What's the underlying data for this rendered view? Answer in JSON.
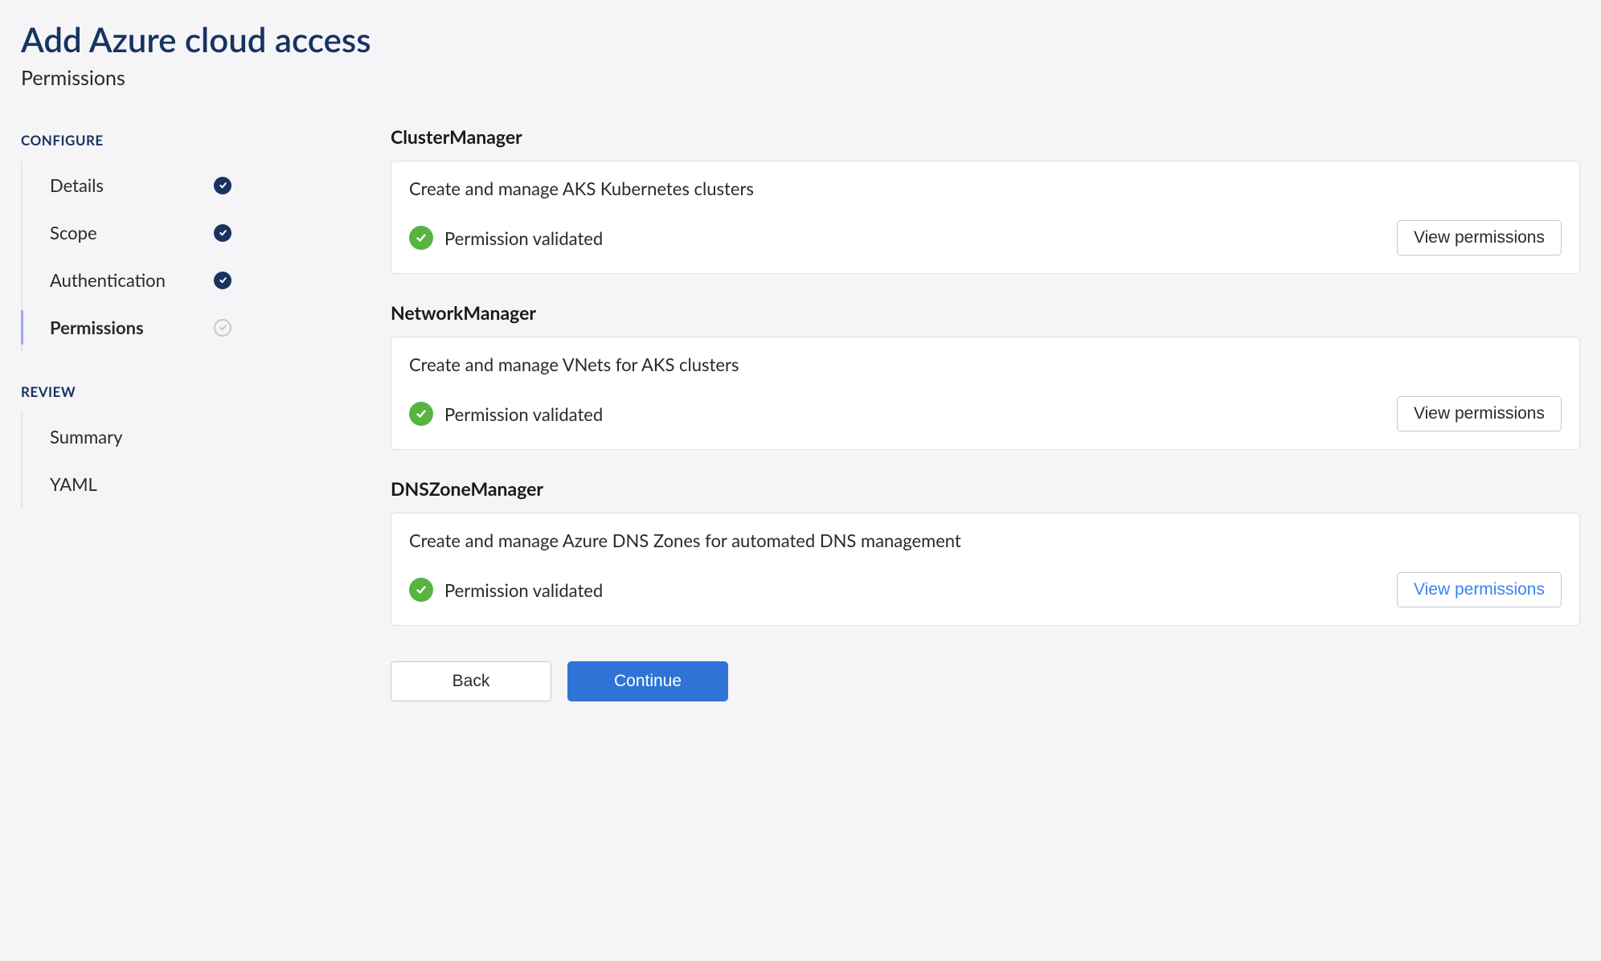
{
  "header": {
    "title": "Add Azure cloud access",
    "subtitle": "Permissions"
  },
  "sidebar": {
    "sections": [
      {
        "label": "CONFIGURE",
        "steps": [
          {
            "label": "Details",
            "state": "done"
          },
          {
            "label": "Scope",
            "state": "done"
          },
          {
            "label": "Authentication",
            "state": "done"
          },
          {
            "label": "Permissions",
            "state": "active"
          }
        ]
      },
      {
        "label": "REVIEW",
        "steps": [
          {
            "label": "Summary",
            "state": "upcoming"
          },
          {
            "label": "YAML",
            "state": "upcoming"
          }
        ]
      }
    ]
  },
  "permissions": [
    {
      "title": "ClusterManager",
      "description": "Create and manage AKS Kubernetes clusters",
      "status_text": "Permission validated",
      "status": "validated",
      "view_label": "View permissions",
      "view_hover": false
    },
    {
      "title": "NetworkManager",
      "description": "Create and manage VNets for AKS clusters",
      "status_text": "Permission validated",
      "status": "validated",
      "view_label": "View permissions",
      "view_hover": false
    },
    {
      "title": "DNSZoneManager",
      "description": "Create and manage Azure DNS Zones for automated DNS management",
      "status_text": "Permission validated",
      "status": "validated",
      "view_label": "View permissions",
      "view_hover": true
    }
  ],
  "actions": {
    "back_label": "Back",
    "continue_label": "Continue"
  },
  "colors": {
    "heading": "#173361",
    "primary_button": "#2f73d7",
    "success": "#56b540",
    "link_hover": "#3b82f6"
  }
}
